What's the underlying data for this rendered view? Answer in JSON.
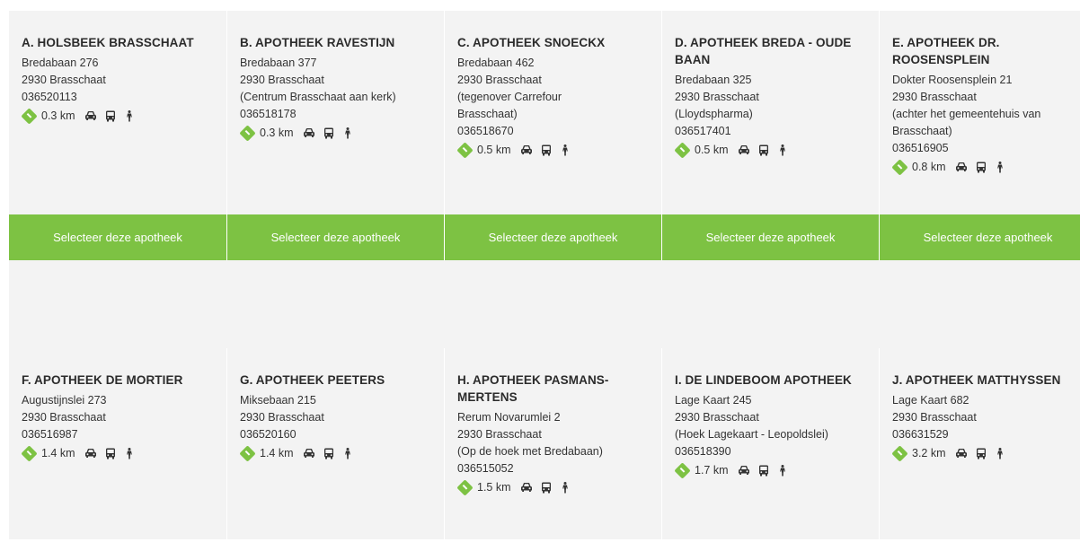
{
  "pharmacies": [
    {
      "name": "A. HOLSBEEK BRASSCHAAT",
      "lines": [
        "Bredabaan 276",
        "2930 Brasschaat",
        "036520113"
      ],
      "distance": "0.3 km"
    },
    {
      "name": "B. APOTHEEK RAVESTIJN",
      "lines": [
        "Bredabaan 377",
        "2930 Brasschaat",
        "(Centrum Brasschaat aan kerk)",
        "036518178"
      ],
      "distance": "0.3 km"
    },
    {
      "name": "C. APOTHEEK SNOECKX",
      "lines": [
        "Bredabaan 462",
        "2930 Brasschaat",
        "(tegenover Carrefour",
        "Brasschaat)",
        "036518670"
      ],
      "distance": "0.5 km"
    },
    {
      "name": "D. APOTHEEK BREDA - OUDE BAAN",
      "lines": [
        "Bredabaan 325",
        "2930 Brasschaat",
        "(Lloydspharma)",
        "036517401"
      ],
      "distance": "0.5 km"
    },
    {
      "name": "E. APOTHEEK DR. ROOSENSPLEIN",
      "lines": [
        "Dokter Roosensplein 21",
        "2930 Brasschaat",
        "(achter het gemeentehuis van",
        "Brasschaat)",
        "036516905"
      ],
      "distance": "0.8 km"
    },
    {
      "name": "F. APOTHEEK DE MORTIER",
      "lines": [
        "Augustijnslei 273",
        "2930 Brasschaat",
        "036516987"
      ],
      "distance": "1.4 km"
    },
    {
      "name": "G. APOTHEEK PEETERS",
      "lines": [
        "Miksebaan 215",
        "2930 Brasschaat",
        "036520160"
      ],
      "distance": "1.4 km"
    },
    {
      "name": "H. APOTHEEK PASMANS-MERTENS",
      "lines": [
        "Rerum Novarumlei 2",
        "2930 Brasschaat",
        "(Op de hoek met Bredabaan)",
        "036515052"
      ],
      "distance": "1.5 km"
    },
    {
      "name": "I. DE LINDEBOOM APOTHEEK",
      "lines": [
        "Lage Kaart 245",
        "2930 Brasschaat",
        "(Hoek Lagekaart - Leopoldslei)",
        "036518390"
      ],
      "distance": "1.7 km"
    },
    {
      "name": "J. APOTHEEK MATTHYSSEN",
      "lines": [
        "Lage Kaart 682",
        "2930 Brasschaat",
        "036631529"
      ],
      "distance": "3.2 km"
    }
  ],
  "select_label": "Selecteer deze apotheek",
  "icons": [
    "route-icon",
    "car-icon",
    "bus-icon",
    "walk-icon"
  ],
  "colors": {
    "accent": "#7dc243",
    "card_bg": "#f3f3f3",
    "text": "#333333"
  }
}
